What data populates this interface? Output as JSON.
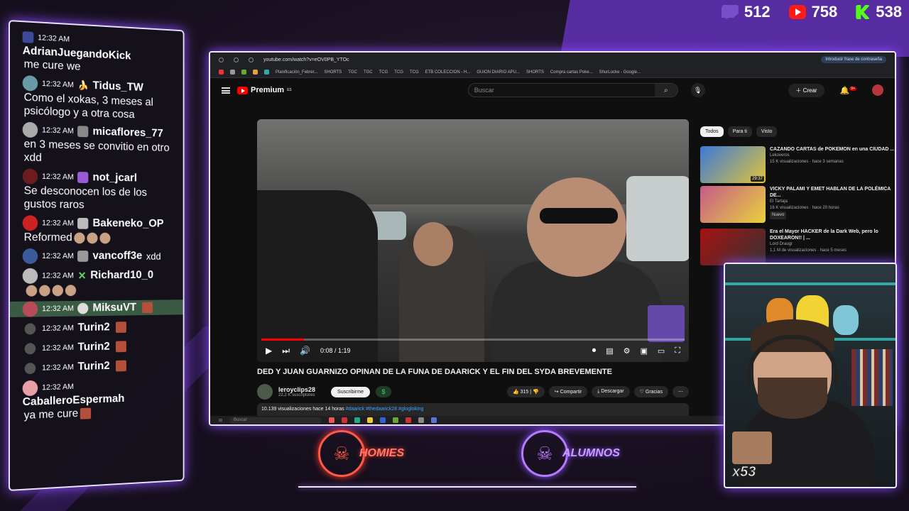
{
  "stats": {
    "twitch_count": "512",
    "youtube_count": "758",
    "kick_count": "538"
  },
  "chat": {
    "messages": [
      {
        "time": "12:32 AM",
        "user": "AdrianJuegandoKick",
        "text": "me cure we"
      },
      {
        "time": "12:32 AM",
        "user": "Tidus_TW",
        "text": "Como el xokas, 3 meses al psicólogo y a otra cosa"
      },
      {
        "time": "12:32 AM",
        "user": "micaflores_77",
        "text": "en 3 meses se convitio en otro xdd"
      },
      {
        "time": "12:32 AM",
        "user": "not_jcarl",
        "text": "Se desconocen los de los gustos raros"
      },
      {
        "time": "12:32 AM",
        "user": "Bakeneko_OP",
        "text": "Reformed"
      },
      {
        "time": "12:32 AM",
        "user": "vancoff3e",
        "text": "xdd"
      },
      {
        "time": "12:32 AM",
        "user": "Richard10_0",
        "text": ""
      },
      {
        "time": "12:32 AM",
        "user": "MiksuVT",
        "text": ""
      },
      {
        "time": "12:32 AM",
        "user": "Turin2",
        "text": ""
      },
      {
        "time": "12:32 AM",
        "user": "Turin2",
        "text": ""
      },
      {
        "time": "12:32 AM",
        "user": "Turin2",
        "text": ""
      },
      {
        "time": "12:32 AM",
        "user": "CaballeroEspermah",
        "text": "ya me cure"
      }
    ]
  },
  "browser": {
    "url": "youtube.com/watch?v=eOV0PB_YTOc",
    "password_hint": "Introducir frase de contraseña",
    "bookmarks": [
      "Planificación_Febrer...",
      "SHORTS",
      "TGC",
      "TGC",
      "TCG",
      "TCG",
      "TCG",
      "ETB COLECCION - H...",
      "GUION DIARIO APU...",
      "SHORTS",
      "Compra cartas Poke...",
      "ShurLocke - Google..."
    ],
    "taskbar_search": "Buscar"
  },
  "youtube": {
    "logo_text": "Premium",
    "logo_region": "ES",
    "search_placeholder": "Buscar",
    "create_label": "Crear",
    "notif_count": "9+",
    "player": {
      "time_label": "0:08 / 1:19",
      "progress": 0.1
    },
    "video_title": "DED Y JUAN GUARNIZO OPINAN DE LA FUNA DE DAARICK Y EL FIN DEL SYDA BREVEMENTE",
    "channel_name": "leroyclips28",
    "channel_subs": "22,2 K suscriptores",
    "subscribe_label": "Suscribirme",
    "likes": "315",
    "share_label": "Compartir",
    "download_label": "Descargar",
    "thanks_label": "Gracias",
    "views_line": "10.139 visualizaciones  hace 14 horas",
    "hashtags": "#daarick #thedaarick28 #glogloking",
    "chips": [
      "Todos",
      "Para ti",
      "Visto"
    ],
    "recommendations": [
      {
        "title": "CAZANDO CARTAS de POKEMON en una CIUDAD ...",
        "channel": "Lekoveros",
        "meta": "15 K visualizaciones · hace 3 semanas",
        "duration": "29:37",
        "badge": ""
      },
      {
        "title": "VICKY PALAMI Y EMET HABLAN DE LA POLÉMICA DE...",
        "channel": "El Tartaja",
        "meta": "16 K visualizaciones · hace 20 horas",
        "duration": "",
        "badge": "Nuevo"
      },
      {
        "title": "Era el Mayor HACKER de la Dark Web, pero lo DOXEARON!! | ...",
        "channel": "Lord Draugr",
        "meta": "1,1 M de visualizaciones · hace 5 meses",
        "duration": "",
        "badge": ""
      }
    ]
  },
  "cam": {
    "combo_count": "x53"
  },
  "logos": {
    "homies": "HOMIES",
    "alumnos": "ALUMNOS"
  },
  "colors": {
    "accent_purple": "#8a4dff",
    "homies_red": "#ff5a45",
    "youtube_red": "#ff0000"
  }
}
